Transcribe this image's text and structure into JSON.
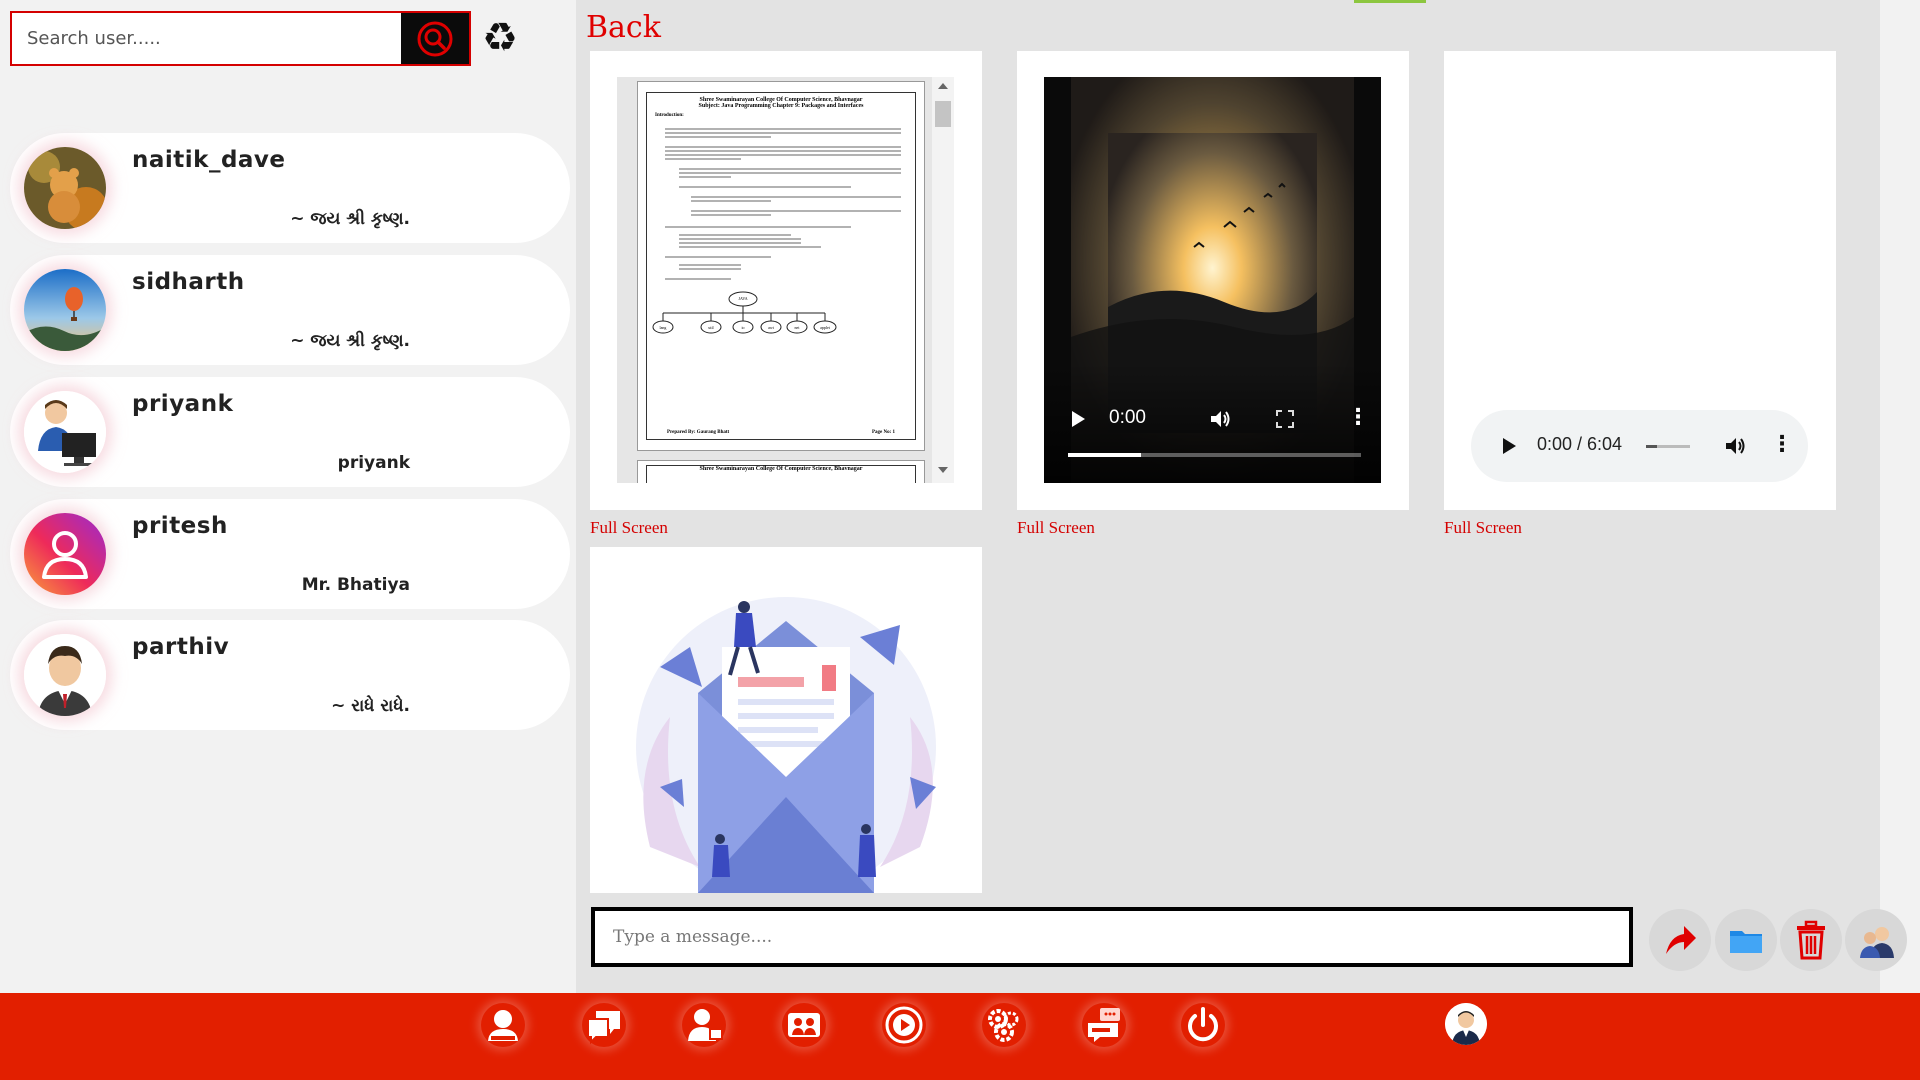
{
  "search": {
    "placeholder": "Search user....."
  },
  "users": [
    {
      "name": "naitik_dave",
      "status": "~ જય શ્રી કૃષ્ણ."
    },
    {
      "name": "sidharth",
      "status": "~ જય શ્રી કૃષ્ણ."
    },
    {
      "name": "priyank",
      "status": "priyank"
    },
    {
      "name": "pritesh",
      "status": "Mr. Bhatiya"
    },
    {
      "name": "parthiv",
      "status": "~ રાધે રાધે."
    }
  ],
  "main": {
    "back_label": "Back",
    "full_screen_label": "Full Screen",
    "document": {
      "college": "Shree Swaminarayan College Of Computer Science, Bhavnagar",
      "subject": "Subject: Java Programming Chapter 9: Packages and Interfaces",
      "section": "Introduction:",
      "diagram_root": "JAVA",
      "diagram_nodes": [
        "lang",
        "util",
        "io",
        "awt",
        "net",
        "applet"
      ],
      "footer_left": "Prepared By: Gaurang Bhatt",
      "footer_right": "Page No: 1",
      "next_page_header": "Shree Swaminarayan College Of Computer Science, Bhavnagar"
    },
    "video": {
      "time": "0:00",
      "progress": 0.25
    },
    "audio": {
      "time": "0:00 / 6:04",
      "volume": 0.25
    }
  },
  "message": {
    "placeholder": "Type a message...."
  },
  "colors": {
    "accent_red": "#e21f00",
    "link_red": "#d40000",
    "top_accent_green": "#8cc63f"
  },
  "action_icons": [
    "send-arrow-icon",
    "folder-icon",
    "trash-icon",
    "group-icon"
  ],
  "nav_icons": [
    "user-profile-icon",
    "chat-icon",
    "contacts-icon",
    "group-chat-icon",
    "video-play-icon",
    "settings-gears-icon",
    "feedback-icon",
    "power-icon",
    "account-avatar-icon"
  ]
}
